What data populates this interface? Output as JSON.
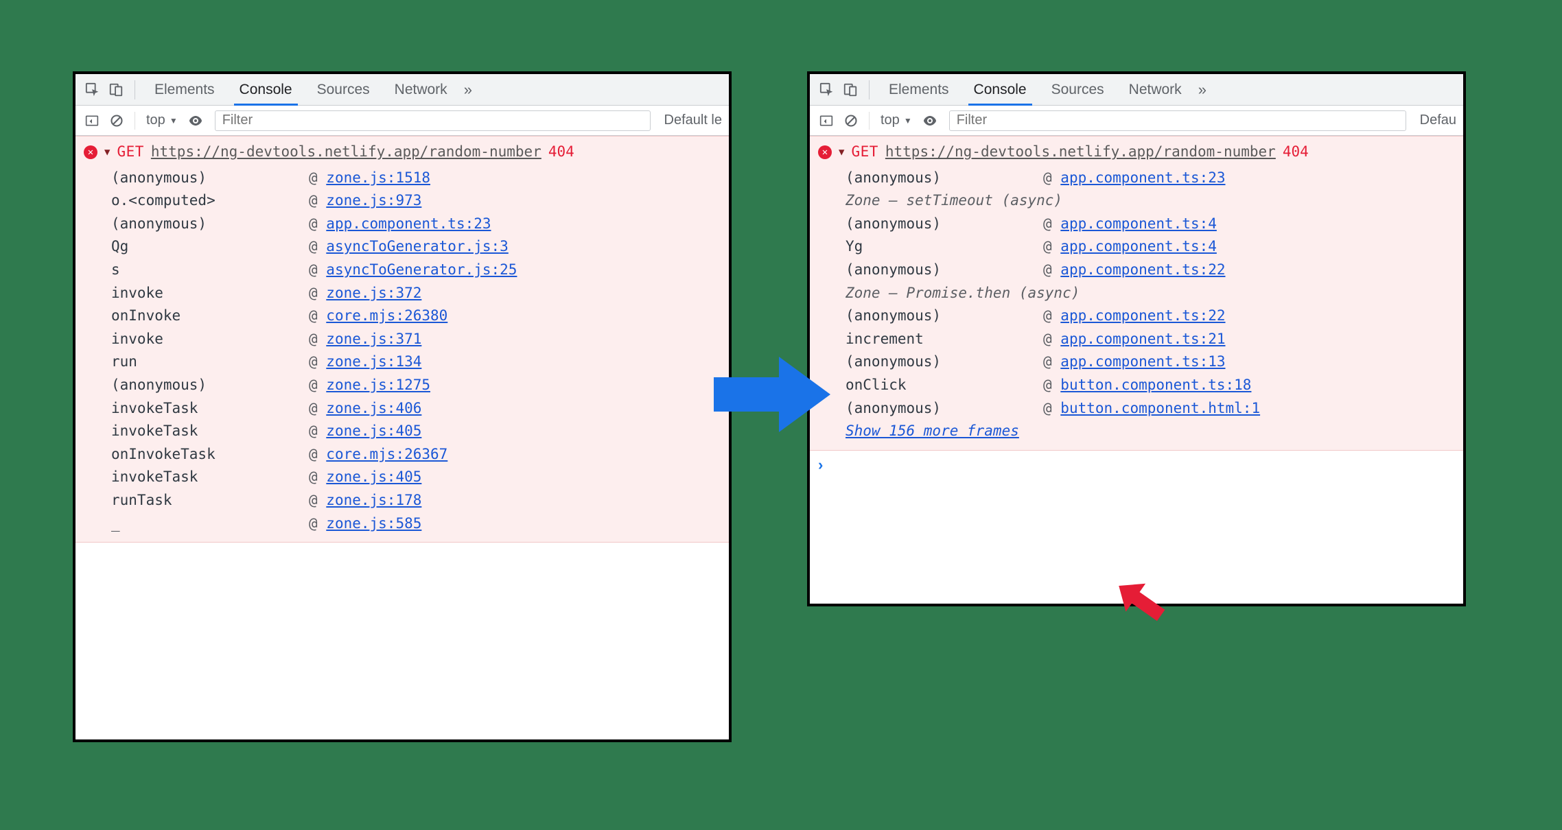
{
  "tabs": [
    "Elements",
    "Console",
    "Sources",
    "Network"
  ],
  "active_tab": "Console",
  "toolbar": {
    "scope": "top",
    "filter_placeholder": "Filter",
    "level_label_left": "Default le",
    "level_label_right": "Defau"
  },
  "error": {
    "method": "GET",
    "url": "https://ng-devtools.netlify.app/random-number",
    "status": "404"
  },
  "left_stack": [
    {
      "fn": "(anonymous)",
      "file": "zone.js:1518"
    },
    {
      "fn": "o.<computed>",
      "file": "zone.js:973"
    },
    {
      "fn": "(anonymous)",
      "file": "app.component.ts:23"
    },
    {
      "fn": "Qg",
      "file": "asyncToGenerator.js:3"
    },
    {
      "fn": "s",
      "file": "asyncToGenerator.js:25"
    },
    {
      "fn": "invoke",
      "file": "zone.js:372"
    },
    {
      "fn": "onInvoke",
      "file": "core.mjs:26380"
    },
    {
      "fn": "invoke",
      "file": "zone.js:371"
    },
    {
      "fn": "run",
      "file": "zone.js:134"
    },
    {
      "fn": "(anonymous)",
      "file": "zone.js:1275"
    },
    {
      "fn": "invokeTask",
      "file": "zone.js:406"
    },
    {
      "fn": "invokeTask",
      "file": "zone.js:405"
    },
    {
      "fn": "onInvokeTask",
      "file": "core.mjs:26367"
    },
    {
      "fn": "invokeTask",
      "file": "zone.js:405"
    },
    {
      "fn": "runTask",
      "file": "zone.js:178"
    },
    {
      "fn": "_",
      "file": "zone.js:585"
    }
  ],
  "right_stack": [
    {
      "fn": "(anonymous)",
      "file": "app.component.ts:23"
    },
    {
      "zone": "Zone — setTimeout (async)"
    },
    {
      "fn": "(anonymous)",
      "file": "app.component.ts:4"
    },
    {
      "fn": "Yg",
      "file": "app.component.ts:4"
    },
    {
      "fn": "(anonymous)",
      "file": "app.component.ts:22"
    },
    {
      "zone": "Zone — Promise.then (async)"
    },
    {
      "fn": "(anonymous)",
      "file": "app.component.ts:22"
    },
    {
      "fn": "increment",
      "file": "app.component.ts:21"
    },
    {
      "fn": "(anonymous)",
      "file": "app.component.ts:13"
    },
    {
      "fn": "onClick",
      "file": "button.component.ts:18"
    },
    {
      "fn": "(anonymous)",
      "file": "button.component.html:1"
    }
  ],
  "show_more": "Show 156 more frames"
}
